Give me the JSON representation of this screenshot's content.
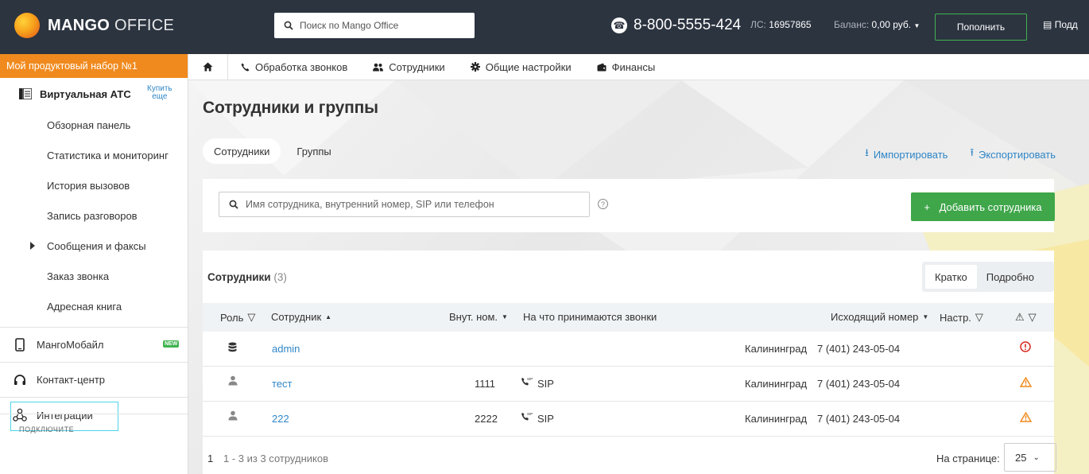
{
  "header": {
    "logo_bold": "MANGO",
    "logo_light": " OFFICE",
    "search_placeholder": "Поиск по Mango Office",
    "phone": "8-800-5555-424",
    "ls_label": "ЛС:",
    "ls_value": "16957865",
    "balance_label": "Баланс:",
    "balance_value": "0,00 руб.",
    "topup_label": "Пополнить",
    "support_label": "Подд"
  },
  "sidebar": {
    "bundle": "Мой продуктовый набор №1",
    "ats_title": "Виртуальная АТС",
    "buy_line1": "Купить",
    "buy_line2": "еще",
    "items": [
      {
        "label": "Обзорная панель"
      },
      {
        "label": "Статистика и мониторинг"
      },
      {
        "label": "История вызовов"
      },
      {
        "label": "Запись разговоров"
      },
      {
        "label": "Сообщения и факсы"
      },
      {
        "label": "Заказ звонка"
      },
      {
        "label": "Адресная книга"
      }
    ],
    "sections": [
      {
        "label": "МангоМобайл",
        "badge": "NEW"
      },
      {
        "label": "Контакт-центр"
      },
      {
        "label": "Интеграции"
      }
    ],
    "connect_label": "ПОДКЛЮЧИТЕ"
  },
  "nav": {
    "items": [
      {
        "label": "Обработка звонков"
      },
      {
        "label": "Сотрудники"
      },
      {
        "label": "Общие настройки"
      },
      {
        "label": "Финансы"
      }
    ]
  },
  "main": {
    "title": "Сотрудники и группы",
    "tabs": [
      {
        "label": "Сотрудники"
      },
      {
        "label": "Группы"
      }
    ],
    "import_label": "Импортировать",
    "export_label": "Экспортировать",
    "search_placeholder": "Имя сотрудника, внутренний номер, SIP или телефон",
    "help_glyph": "?",
    "add_label": "Добавить сотрудника",
    "table_title": "Сотрудники",
    "table_count": "(3)",
    "view_short": "Кратко",
    "view_detailed": "Подробно",
    "columns": {
      "role": "Роль",
      "employee": "Сотрудник",
      "ext": "Внут. ном.",
      "receive": "На что принимаются звонки",
      "outgoing": "Исходящий номер",
      "settings": "Настр."
    },
    "rows": [
      {
        "name": "admin",
        "ext": "",
        "receive": "",
        "city": "Калининград",
        "number": "7 (401) 243-05-04",
        "status": "error"
      },
      {
        "name": "тест",
        "ext": "1111",
        "receive": "SIP",
        "city": "Калининград",
        "number": "7 (401) 243-05-04",
        "status": "warning"
      },
      {
        "name": "222",
        "ext": "2222",
        "receive": "SIP",
        "city": "Калининград",
        "number": "7 (401) 243-05-04",
        "status": "warning"
      }
    ],
    "pager_page": "1",
    "pager_info": "1 - 3 из 3 сотрудников",
    "per_page_label": "На странице:",
    "per_page_value": "25",
    "colors": {
      "accent": "#2f86c7",
      "green": "#3fa64a",
      "orange": "#f08a1e",
      "error": "#d9291c",
      "warning": "#f08a1e"
    }
  }
}
